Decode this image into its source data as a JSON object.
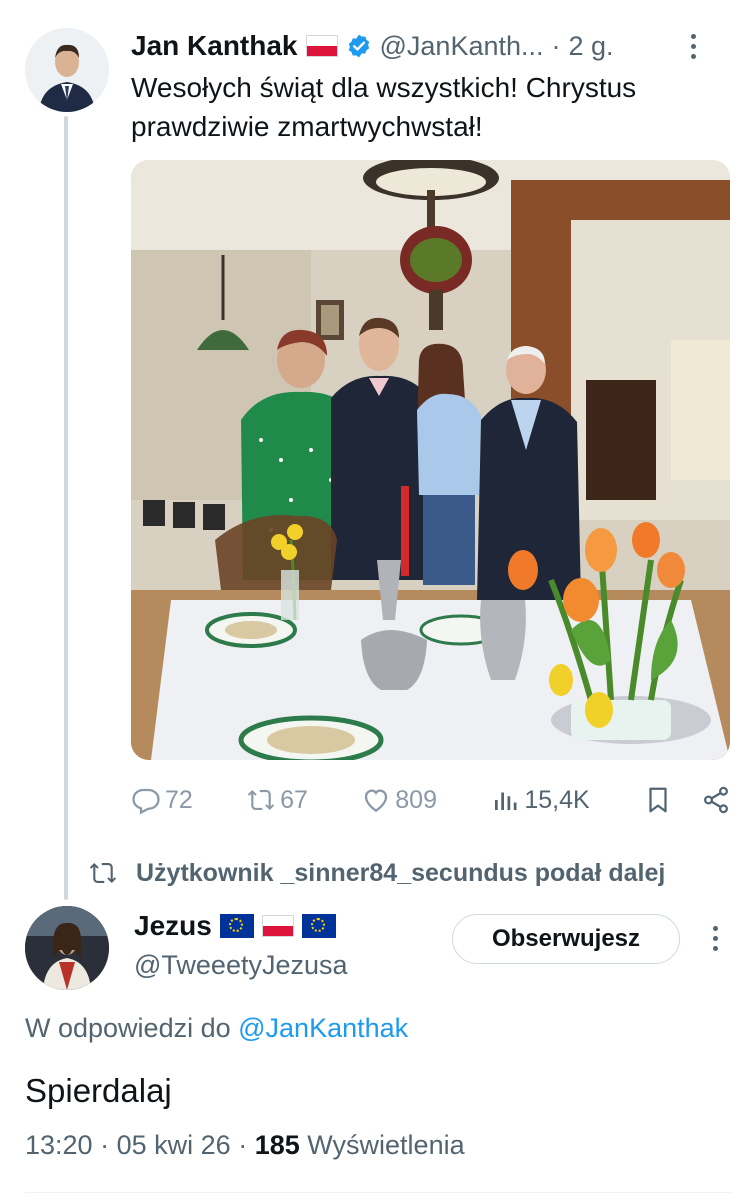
{
  "tweet1": {
    "author_name": "Jan Kanthak",
    "author_handle": "@JanKanth...",
    "separator": "·",
    "age": "2 g.",
    "text": "Wesołych świąt dla wszystkich! Chrystus prawdziwie zmartwychwstał!",
    "stats": {
      "replies": "72",
      "retweets": "67",
      "likes": "809",
      "views": "15,4K"
    }
  },
  "retweet_note": "Użytkownik _sinner84_secundus podał dalej",
  "tweet2": {
    "author_name": "Jezus",
    "author_handle": "@TweeetyJezusa",
    "follow_label": "Obserwujesz",
    "reply_prefix": "W odpowiedzi do ",
    "reply_handle": "@JanKanthak",
    "text": "Spierdalaj",
    "time": "13:20",
    "sep1": "·",
    "date": "05 kwi 26",
    "sep2": "·",
    "views_count": "185",
    "views_label": "Wyświetlenia"
  },
  "colors": {
    "accent": "#1d9bf0",
    "muted": "#536471",
    "text": "#0f1419",
    "border": "#cfd9de"
  },
  "icons": [
    "verified-badge-icon",
    "flag-poland-icon",
    "flag-eu-icon",
    "reply-icon",
    "retweet-icon",
    "like-icon",
    "views-icon",
    "bookmark-icon",
    "share-icon",
    "more-icon"
  ]
}
